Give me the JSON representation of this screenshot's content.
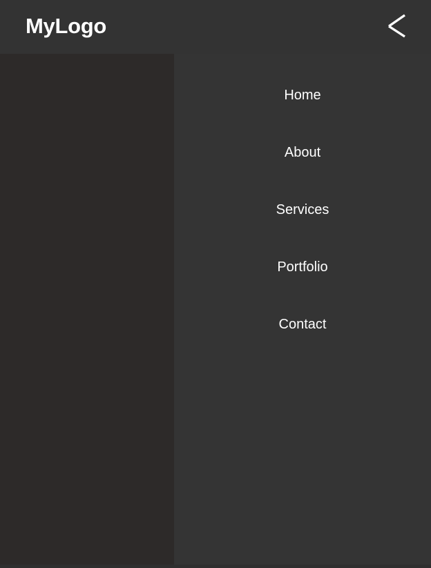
{
  "header": {
    "logo_text": "MyLogo",
    "close_icon": "close-icon"
  },
  "menu": {
    "items": [
      {
        "label": "Home"
      },
      {
        "label": "About"
      },
      {
        "label": "Services"
      },
      {
        "label": "Portfolio"
      },
      {
        "label": "Contact"
      }
    ]
  },
  "colors": {
    "header_bg": "#333333",
    "overlay_bg": "#2d2a29",
    "menu_bg": "#343434",
    "text": "#ffffff"
  }
}
